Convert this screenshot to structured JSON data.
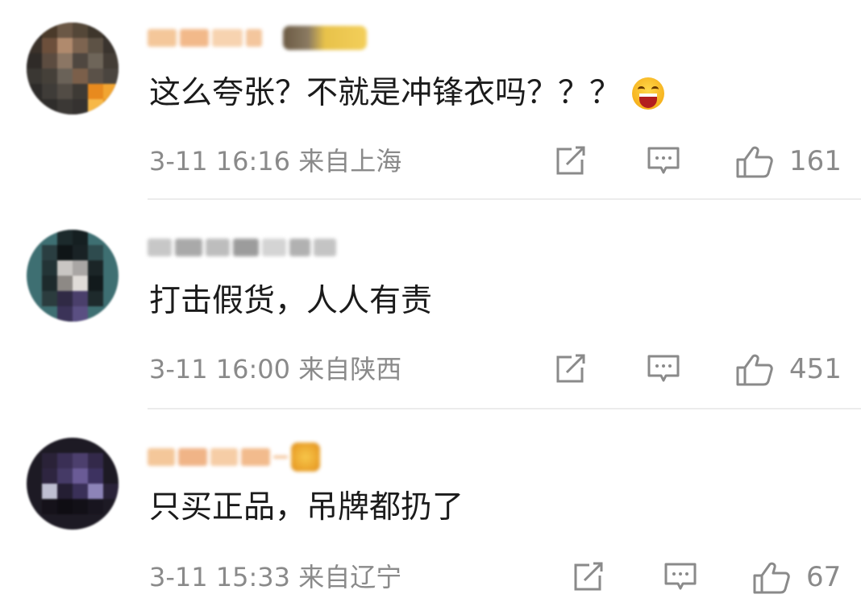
{
  "comments": [
    {
      "text": "这么夸张？不就是冲锋衣吗？？？",
      "emoji": "grinning-face-emoji",
      "time_location": "3-11 16:16  来自上海",
      "likes": "161"
    },
    {
      "text": "打击假货，人人有责",
      "time_location": "3-11 16:00  来自陕西",
      "likes": "451"
    },
    {
      "text": "只买正品，吊牌都扔了",
      "time_location": "3-11 15:33  来自辽宁",
      "likes": "67"
    }
  ],
  "icons": {
    "share": "share-icon",
    "reply": "comment-icon",
    "like": "thumbs-up-icon"
  },
  "colors": {
    "meta_text": "#8a8a8a",
    "body_text": "#1b1b1b",
    "divider": "#ececec"
  }
}
